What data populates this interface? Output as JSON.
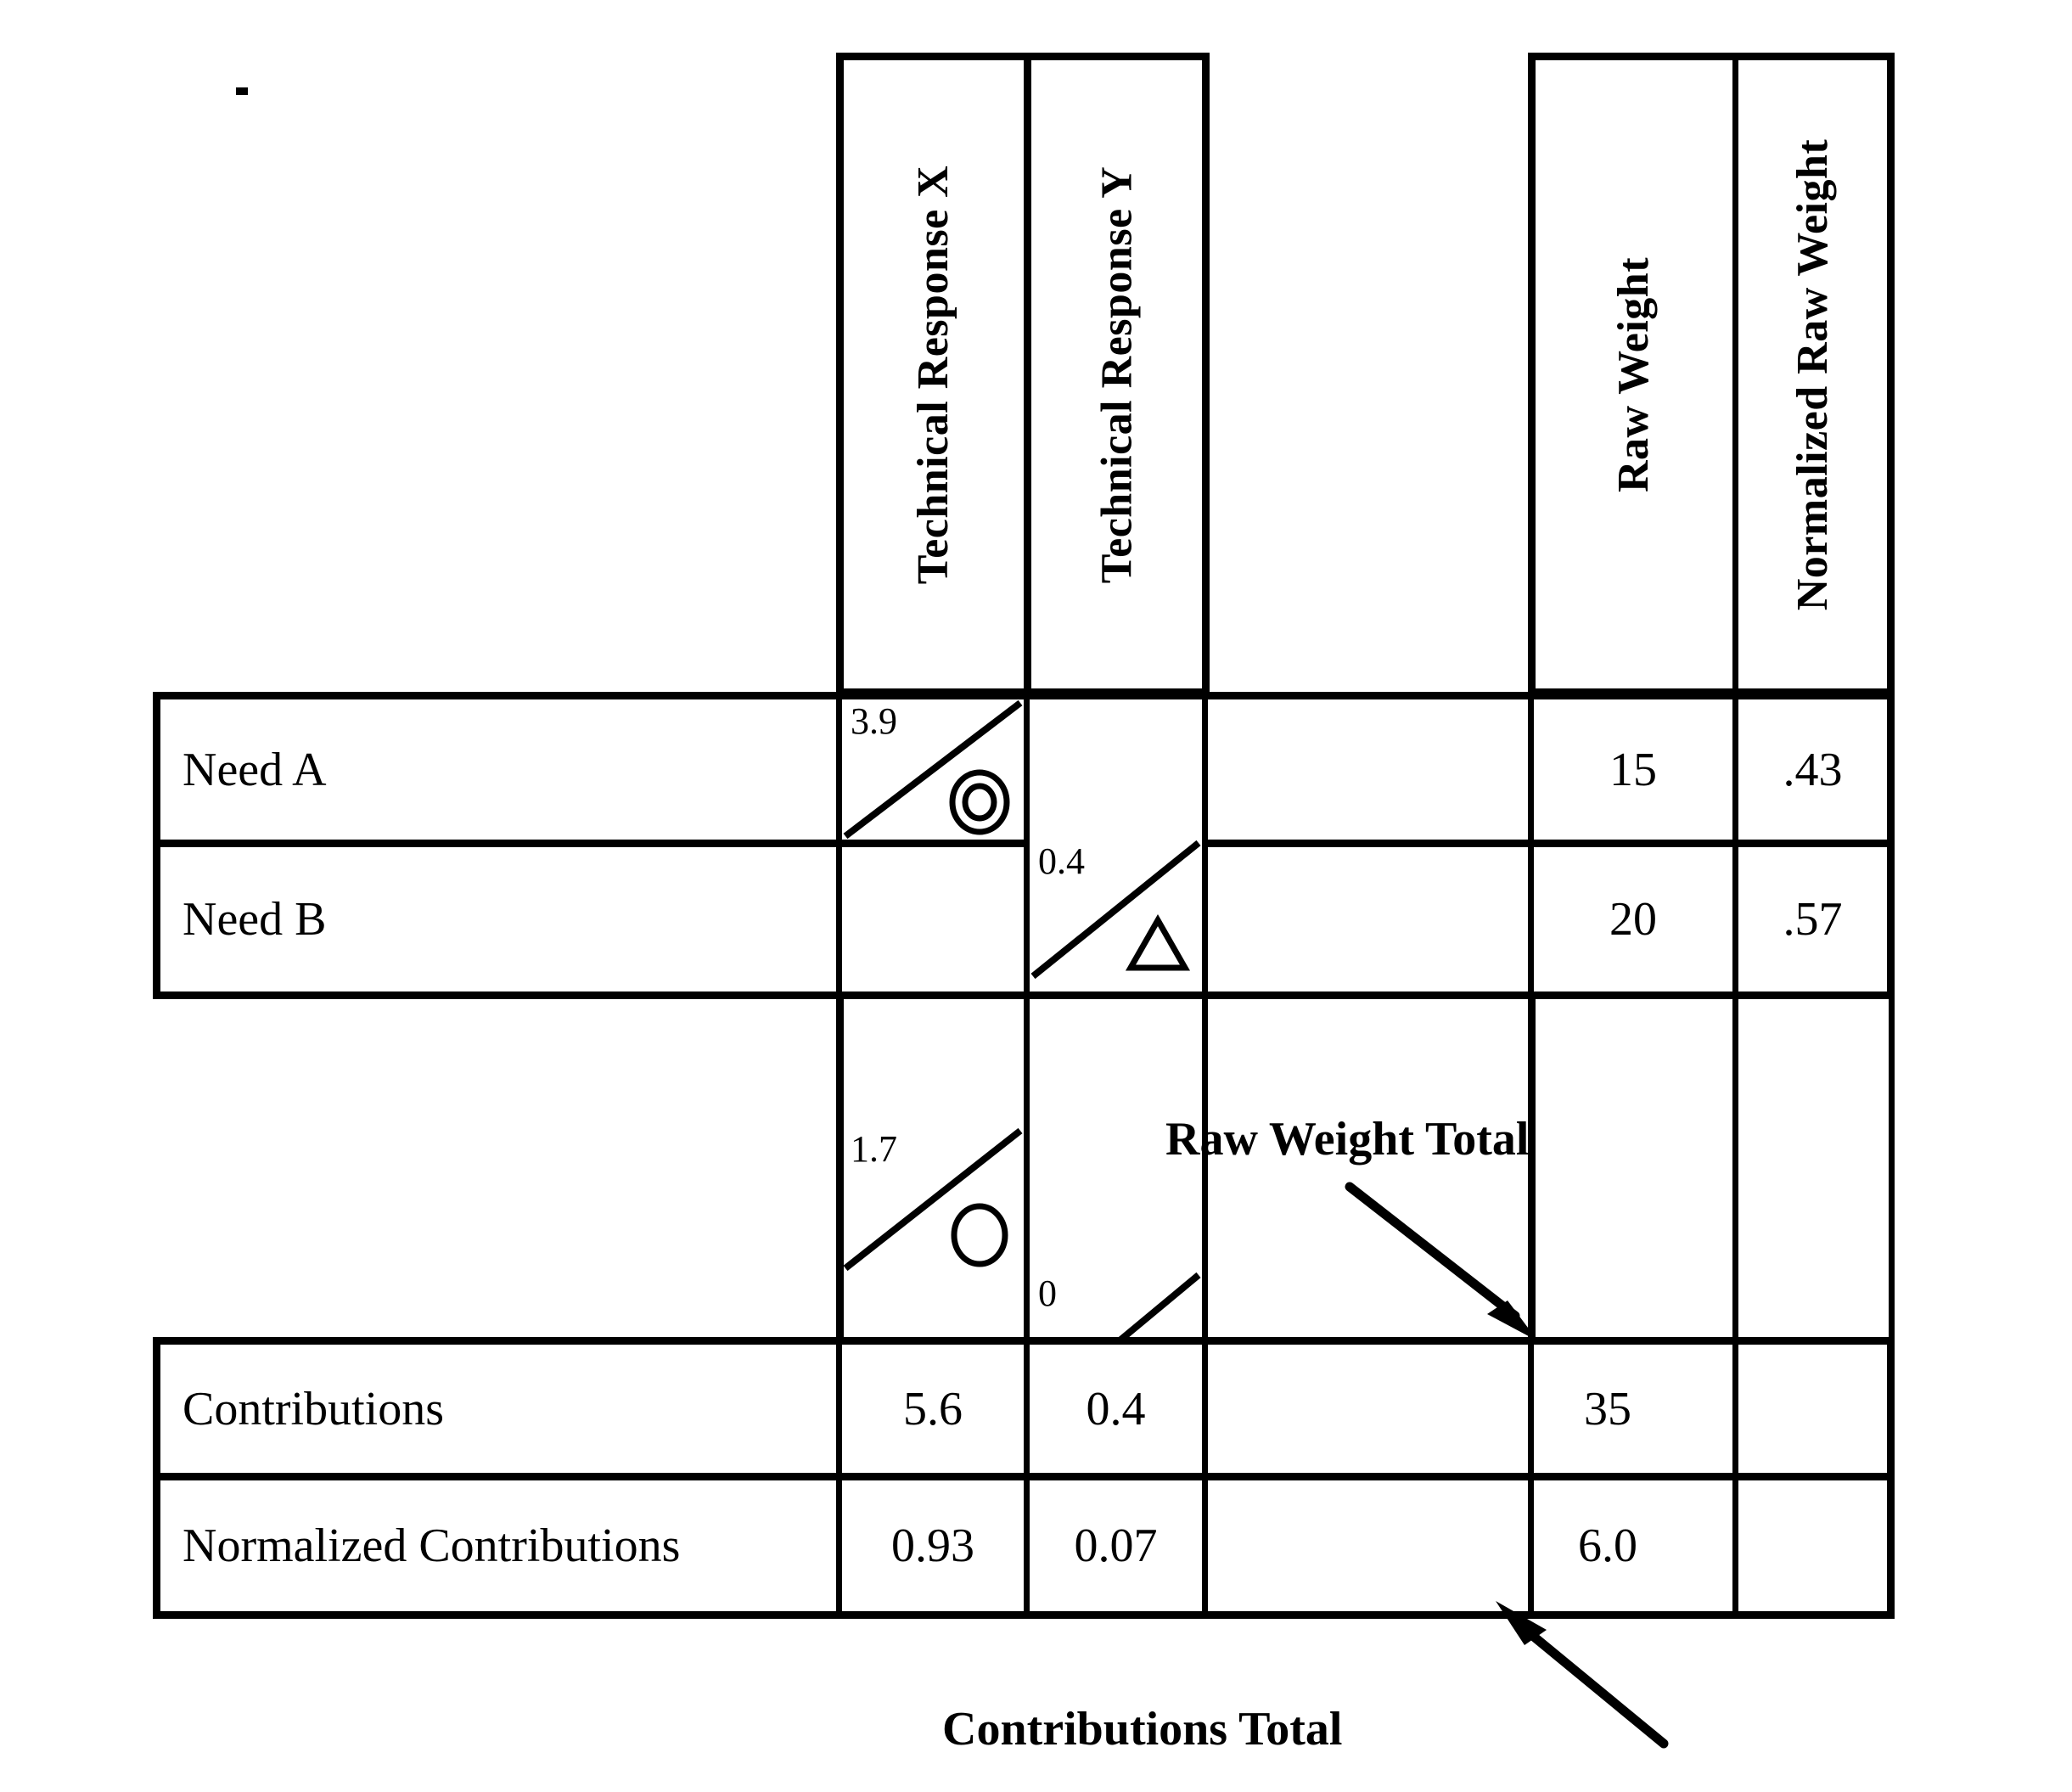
{
  "diagram": {
    "type": "qfd-house-of-quality-matrix",
    "column_headers": [
      {
        "id": "technical-response-x",
        "label": "Technical Response X",
        "orientation": "vertical"
      },
      {
        "id": "technical-response-y",
        "label": "Technical Response Y",
        "orientation": "vertical"
      },
      {
        "id": "raw-weight",
        "label": "Raw Weight",
        "orientation": "vertical"
      },
      {
        "id": "normalized-raw-weight",
        "label": "Normalized Raw Weight",
        "orientation": "vertical"
      }
    ],
    "needs": [
      {
        "label": "Need A",
        "cells": [
          {
            "column": "technical-response-x",
            "value": "3.9",
            "symbol": "double-circle"
          },
          {
            "column": "technical-response-y",
            "value": "0.4",
            "symbol": "triangle"
          }
        ],
        "raw_weight": "15",
        "normalized_raw_weight": ".43"
      },
      {
        "label": "Need B",
        "cells": [
          {
            "column": "technical-response-x",
            "value": "1.7",
            "symbol": "circle"
          },
          {
            "column": "technical-response-y",
            "value": "0",
            "symbol": "none"
          }
        ],
        "raw_weight": "20",
        "normalized_raw_weight": ".57"
      }
    ],
    "summary_rows": [
      {
        "label": "Contributions",
        "technical_response_x": "5.6",
        "technical_response_y": "0.4",
        "raw_weight": "35",
        "normalized_raw_weight": ""
      },
      {
        "label": "Normalized Contributions",
        "technical_response_x": "0.93",
        "technical_response_y": "0.07",
        "raw_weight": "6.0",
        "normalized_raw_weight": ""
      }
    ],
    "annotations": [
      {
        "id": "raw-weight-total",
        "label": "Raw Weight Total",
        "points_to": "35"
      },
      {
        "id": "contributions-total",
        "label": "Contributions Total",
        "points_to": "6.0"
      }
    ],
    "colors": {
      "ink": "#000000",
      "paper": "#ffffff"
    }
  }
}
